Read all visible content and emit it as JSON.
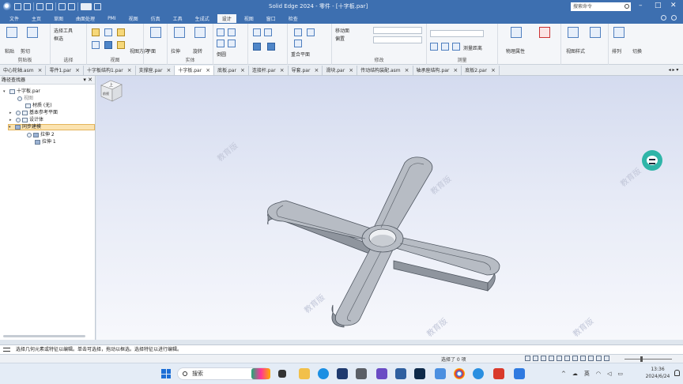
{
  "window": {
    "title": "Solid Edge 2024 - 零件 - [十字板.par]",
    "search_placeholder": "搜索命令",
    "minimize": "–",
    "restore": "□",
    "close": "✕"
  },
  "menu": {
    "items": [
      "文件",
      "主页",
      "草图",
      "曲面处理",
      "PMI",
      "视图",
      "仿真",
      "工具",
      "生成式",
      "设计",
      "视图",
      "窗口",
      "检查"
    ],
    "active_index": 9
  },
  "ribbon": {
    "groups": [
      {
        "name": "剪贴板",
        "labels": [
          "粘贴",
          "选择",
          "剪切"
        ]
      },
      {
        "name": "选择",
        "labels": [
          "选择工具",
          "框选"
        ]
      },
      {
        "name": "视图",
        "labels": [
          "视图方向"
        ]
      },
      {
        "name": "草图",
        "labels": [
          "平面"
        ]
      },
      {
        "name": "实体",
        "labels": [
          "拉伸",
          "旋转"
        ]
      },
      {
        "name": "特征",
        "labels": [
          "倒圆",
          "阵列"
        ]
      },
      {
        "name": "方向",
        "labels": [
          "镜像"
        ]
      },
      {
        "name": "基准面",
        "labels": [
          "重合平面"
        ]
      },
      {
        "name": "修改",
        "labels": [
          "移动面",
          "偏置"
        ]
      },
      {
        "name": "测量",
        "labels": [
          "测量距离"
        ]
      },
      {
        "name": "属性",
        "labels": [
          "物理属性"
        ]
      },
      {
        "name": "样式",
        "labels": [
          "视图样式"
        ]
      },
      {
        "name": "窗口",
        "labels": [
          "排列",
          "切换"
        ]
      }
    ]
  },
  "doc_tabs": [
    {
      "label": "中心轮轴.asm"
    },
    {
      "label": "零件1.par"
    },
    {
      "label": "十字板结构1.par"
    },
    {
      "label": "支撑座.par"
    },
    {
      "label": "十字板.par",
      "active": true
    },
    {
      "label": "底板.par"
    },
    {
      "label": "连接杆.par"
    },
    {
      "label": "导套.par"
    },
    {
      "label": "滑块.par"
    },
    {
      "label": "传动结构装配.asm"
    },
    {
      "label": "轴承座结构.par"
    },
    {
      "label": "底板2.par"
    }
  ],
  "pathfinder": {
    "title": "路径查找器",
    "nodes": [
      {
        "label": "十字板.par",
        "level": 0,
        "expand": "▾"
      },
      {
        "label": "视图",
        "level": 1,
        "gray": true
      },
      {
        "label": "材质 (无)",
        "level": 1
      },
      {
        "label": "基本参考平面",
        "level": 1,
        "expand": "▸"
      },
      {
        "label": "设计体",
        "level": 1,
        "expand": "▸"
      },
      {
        "label": "同步建模",
        "level": 0,
        "expand": "▾",
        "highlight": true
      },
      {
        "label": "拉伸 2",
        "level": 2
      },
      {
        "label": "拉伸 1",
        "level": 2
      }
    ]
  },
  "prompt": {
    "text": "选择几何元素或特征以编辑。单击可选择，拖动以框选。选择特征以进行编辑。"
  },
  "status": {
    "selection": "选择了 0 项"
  },
  "viewport": {
    "watermark": "教育版",
    "view_cube_top": "上",
    "view_cube_front": "前视"
  },
  "taskbar": {
    "search": "搜索",
    "lang": "英",
    "time": "13:36",
    "date": "2024/6/24"
  }
}
